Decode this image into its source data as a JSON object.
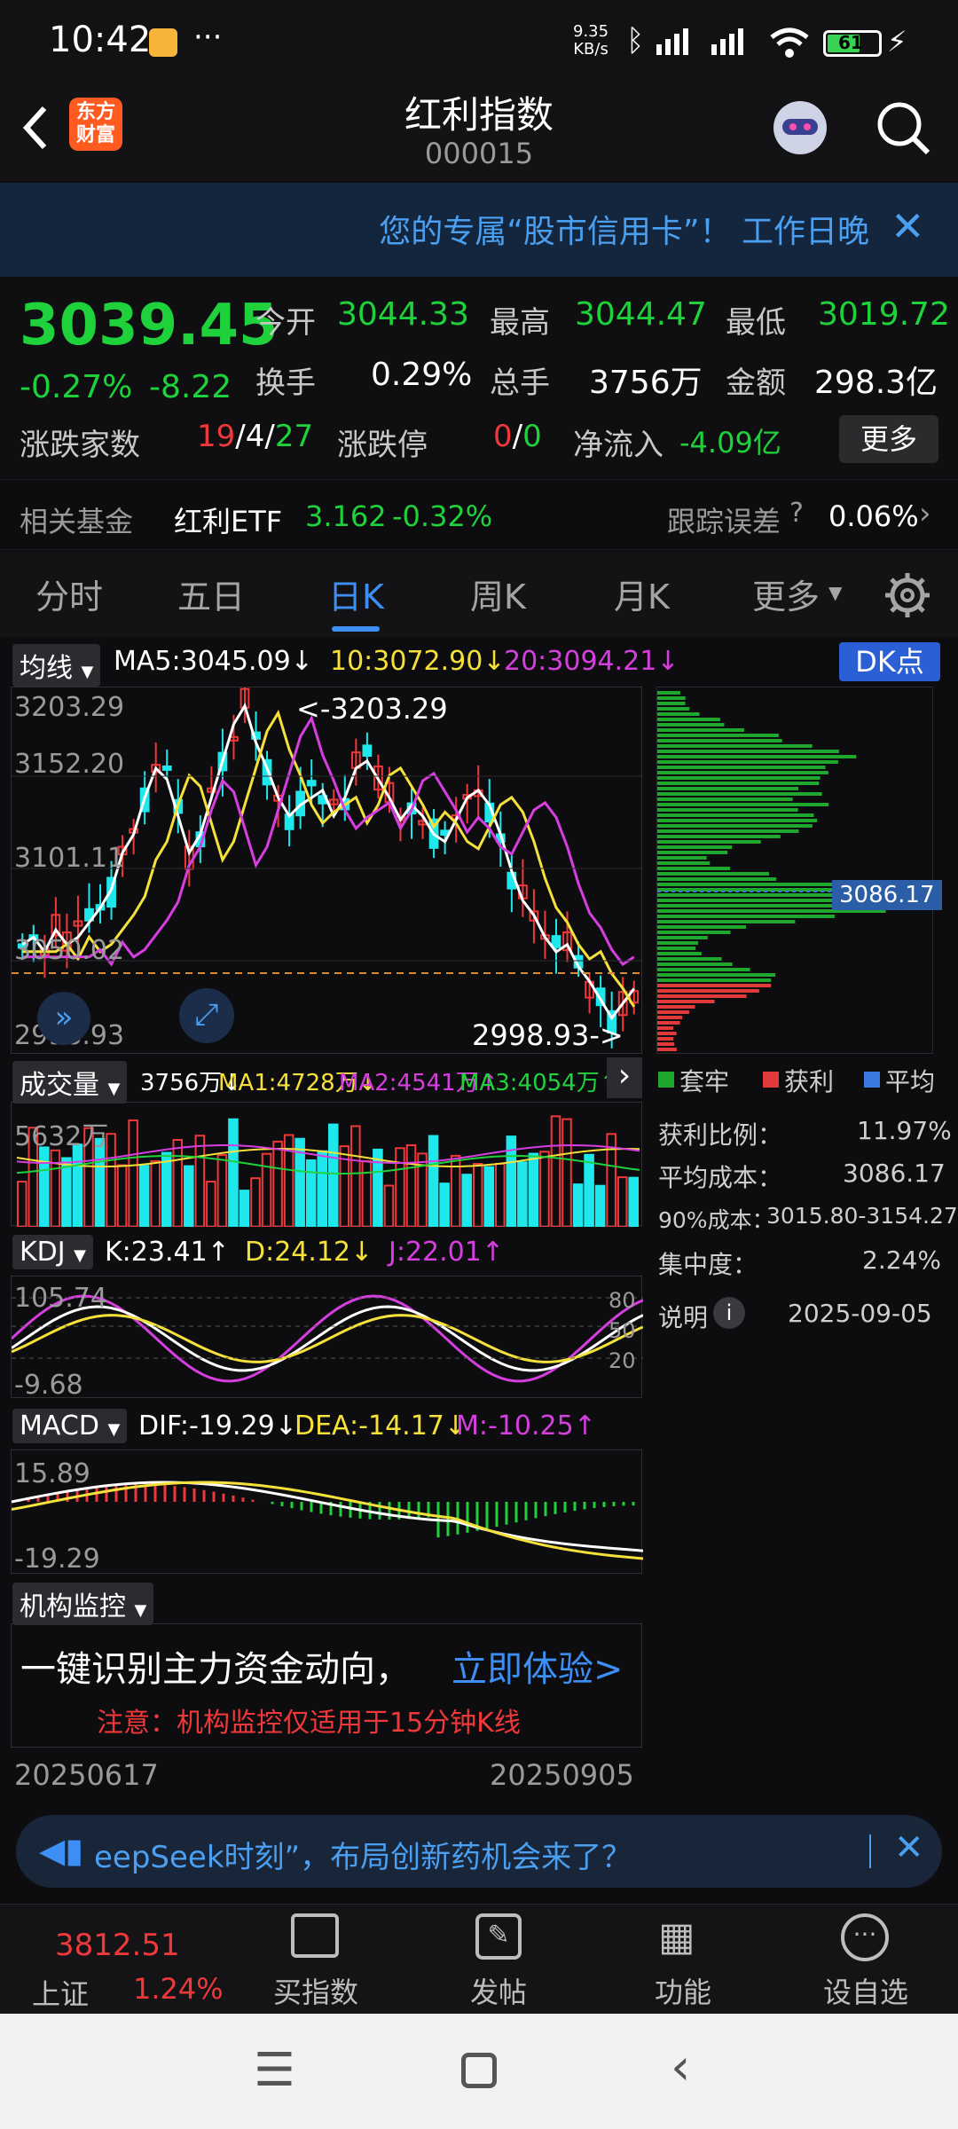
{
  "status_bar": {
    "time": "10:42",
    "net_speed_top": "9.35",
    "net_speed_unit": "KB/s",
    "battery": "61"
  },
  "header": {
    "title": "红利指数",
    "code": "000015",
    "logo_line1": "东方",
    "logo_line2": "财富"
  },
  "banner": {
    "text": "您的专属“股市信用卡”！ 工作日晚"
  },
  "quote": {
    "price": "3039.45",
    "change_pct": "-0.27%",
    "change": "-8.22",
    "open_label": "今开",
    "open": "3044.33",
    "high_label": "最高",
    "high": "3044.47",
    "low_label": "最低",
    "low": "3019.72",
    "turnover_label": "换手",
    "turnover": "0.29%",
    "volume_label": "总手",
    "volume": "3756万",
    "amount_label": "金额",
    "amount": "298.3亿",
    "breadth_label": "涨跌家数",
    "up": "19",
    "flat": "4",
    "down": "27",
    "limit_label": "涨跌停",
    "limit_up": "0",
    "limit_down": "0",
    "netflow_label": "净流入",
    "netflow": "-4.09亿",
    "more": "更多"
  },
  "fund": {
    "label": "相关基金",
    "name": "红利ETF",
    "price": "3.162",
    "change": "-0.32%",
    "track_label": "跟踪误差",
    "track_value": "0.06%"
  },
  "tabs": [
    "分时",
    "五日",
    "日K",
    "周K",
    "月K",
    "更多"
  ],
  "ma": {
    "chip": "均线",
    "ma5": "MA5:3045.09↓",
    "ma10": "10:3072.90↓",
    "ma20": "20:3094.21↓",
    "dk": "DK点"
  },
  "kline": {
    "y_labels": [
      "3203.29",
      "3152.20",
      "3101.11",
      "3050.02",
      "2998.93"
    ],
    "high_marker": "<-3203.29",
    "low_marker": "2998.93->",
    "avg_cost_tag": "3086.17"
  },
  "volume": {
    "chip": "成交量",
    "vol": "3756万↓",
    "ma1": "MA1:4728万↓",
    "ma2": "MA2:4541万↑",
    "ma3": "MA3:4054万↑",
    "y_label": "5632万"
  },
  "kdj": {
    "chip": "KDJ",
    "k": "K:23.41↑",
    "d": "D:24.12↓",
    "j": "J:22.01↑",
    "y_top": "105.74",
    "y_bottom": "-9.68",
    "l80": "80",
    "l50": "50",
    "l20": "20"
  },
  "macd": {
    "chip": "MACD",
    "dif": "DIF:-19.29↓",
    "dea": "DEA:-14.17↓",
    "m": "M:-10.25↑",
    "y_top": "15.89",
    "y_bottom": "-19.29"
  },
  "institution": {
    "chip": "机构监控",
    "headline": "一键识别主力资金动向，",
    "cta": "立即体验>",
    "note": "注意：机构监控仅适用于15分钟K线"
  },
  "dates": {
    "start": "20250617",
    "end": "20250905"
  },
  "chip_panel": {
    "legend": [
      "套牢",
      "获利",
      "平均"
    ],
    "profit_label": "获利比例：",
    "profit": "11.97%",
    "avg_label": "平均成本：",
    "avg": "3086.17",
    "c90_label": "90%成本：",
    "c90": "3015.80-3154.27",
    "conc_label": "集中度：",
    "conc": "2.24%",
    "explain": "说明",
    "date": "2025-09-05"
  },
  "notice": {
    "text": "eepSeek时刻”，布局创新药机会来了？"
  },
  "bottom_nav": {
    "index_value": "3812.51",
    "index_name": "上证",
    "index_change": "1.24%",
    "items": [
      "买指数",
      "发帖",
      "功能",
      "设自选"
    ]
  },
  "colors": {
    "up": "#f0383a",
    "down": "#1fd23c",
    "accent": "#3d8ff5",
    "ma5": "#ffffff",
    "ma10": "#f5e13a",
    "ma20": "#d63ee0",
    "vol_up": "#f0383a",
    "vol_down": "#1ee8ec"
  }
}
